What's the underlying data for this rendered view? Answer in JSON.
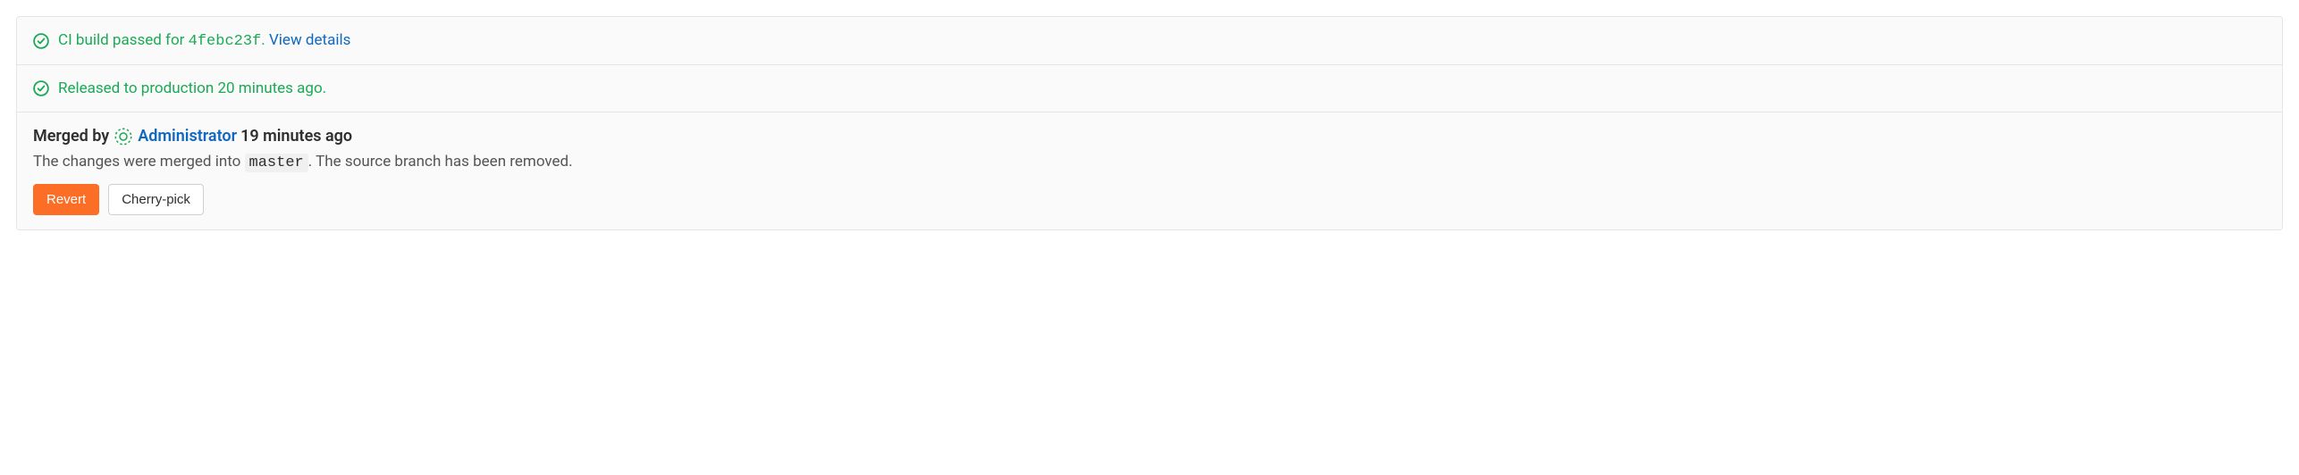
{
  "ci_status": {
    "text_prefix": "CI build passed for ",
    "commit_sha": "4febc23f",
    "separator": ". ",
    "view_details_label": "View details"
  },
  "release_status": {
    "text": "Released to production 20 minutes ago."
  },
  "merged": {
    "by_label": "Merged by",
    "user_name": "Administrator",
    "time": "19 minutes ago",
    "desc_prefix": "The changes were merged into ",
    "branch": "master",
    "desc_suffix": ". The source branch has been removed."
  },
  "actions": {
    "revert_label": "Revert",
    "cherry_pick_label": "Cherry-pick"
  }
}
